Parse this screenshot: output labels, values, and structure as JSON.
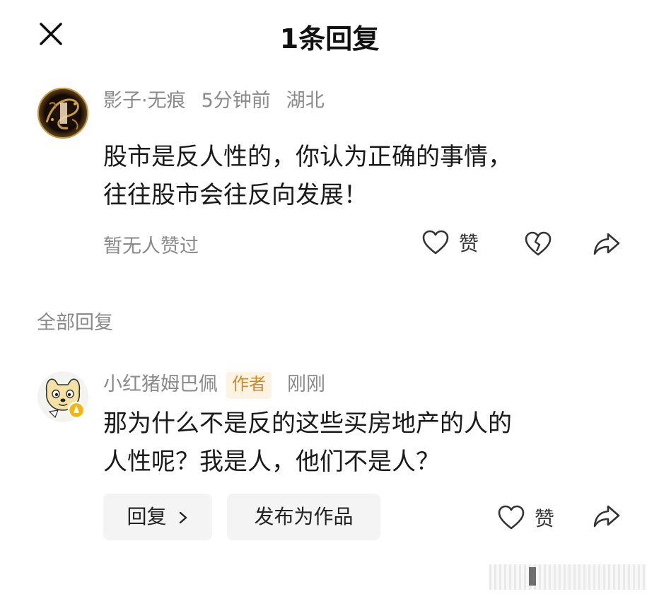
{
  "header": {
    "title": "1条回复",
    "close_icon": "close-icon"
  },
  "main_comment": {
    "username": "影子·无痕",
    "time": "5分钟前",
    "location": "湖北",
    "text_line1": "股市是反人性的，你认为正确的事情，",
    "text_line2": "往往股市会往反向发展！",
    "no_likes": "暂无人赞过",
    "like_label": "赞",
    "icons": [
      "heart-outline-icon",
      "broken-heart-icon",
      "share-icon"
    ]
  },
  "section_label": "全部回复",
  "reply": {
    "username": "小红猪姆巴佩",
    "author_tag": "作者",
    "time": "刚刚",
    "text_line1": "那为什么不是反的这些买房地产的人的",
    "text_line2": "人性呢？我是人，他们不是人？",
    "reply_button": "回复",
    "publish_button": "发布为作品",
    "like_label": "赞",
    "icons": [
      "chevron-right-icon",
      "heart-outline-icon",
      "share-icon"
    ]
  },
  "colors": {
    "meta_gray": "#8a8a8a",
    "author_tag_bg": "#fdf3e2",
    "author_tag_text": "#c98a2d",
    "pill_bg": "#f4f4f4"
  }
}
